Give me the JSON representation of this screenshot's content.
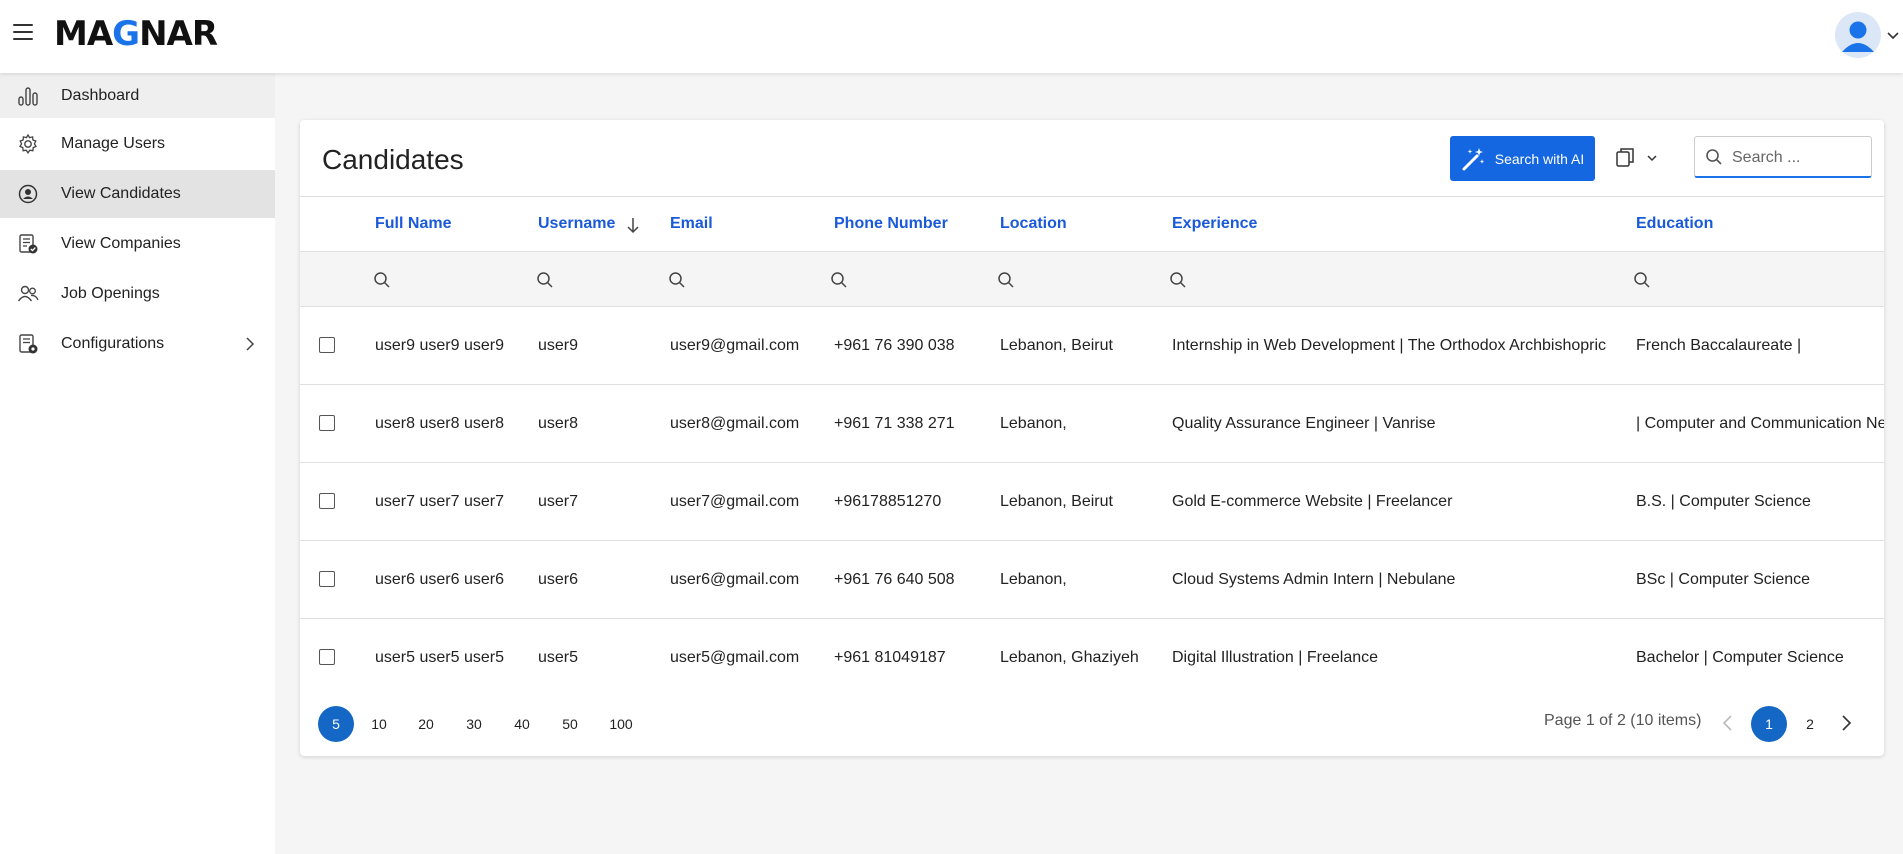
{
  "app": {
    "logo_prefix": "MA",
    "logo_accent": "G",
    "logo_suffix": "NAR"
  },
  "sidebar": {
    "items": [
      {
        "label": "Dashboard",
        "icon": "bar-chart-icon"
      },
      {
        "label": "Manage Users",
        "icon": "gear-icon"
      },
      {
        "label": "View Candidates",
        "icon": "user-circle-icon",
        "active": true
      },
      {
        "label": "View Companies",
        "icon": "document-check-icon"
      },
      {
        "label": "Job Openings",
        "icon": "users-icon"
      },
      {
        "label": "Configurations",
        "icon": "document-gear-icon",
        "has_submenu": true
      }
    ]
  },
  "page": {
    "title": "Candidates",
    "ai_button": "Search with AI",
    "search_placeholder": "Search ..."
  },
  "table": {
    "columns": [
      "Full Name",
      "Username",
      "Email",
      "Phone Number",
      "Location",
      "Experience",
      "Education"
    ],
    "sorted_column": "Username",
    "sort_direction": "descending",
    "rows": [
      [
        "user9 user9 user9",
        "user9",
        "user9@gmail.com",
        "+961 76 390 038",
        "Lebanon, Beirut",
        "Internship in Web Development | The Orthodox Archbishopric",
        "French Baccalaureate |"
      ],
      [
        "user8 user8 user8",
        "user8",
        "user8@gmail.com",
        "+961 71 338 271",
        "Lebanon,",
        "Quality Assurance Engineer | Vanrise",
        "| Computer and Communication Networks"
      ],
      [
        "user7 user7 user7",
        "user7",
        "user7@gmail.com",
        "+96178851270",
        "Lebanon, Beirut",
        "Gold E-commerce Website | Freelancer",
        "B.S. | Computer Science"
      ],
      [
        "user6 user6 user6",
        "user6",
        "user6@gmail.com",
        "+961 76 640 508",
        "Lebanon,",
        "Cloud Systems Admin Intern | Nebulane",
        "BSc | Computer Science"
      ],
      [
        "user5 user5 user5",
        "user5",
        "user5@gmail.com",
        "+961 81049187",
        "Lebanon, Ghaziyeh",
        "Digital Illustration | Freelance",
        "Bachelor | Computer Science"
      ]
    ]
  },
  "pagination": {
    "page_sizes": [
      "5",
      "10",
      "20",
      "30",
      "40",
      "50",
      "100"
    ],
    "selected_page_size": "5",
    "info": "Page 1 of 2 (10 items)",
    "pages": [
      "1",
      "2"
    ],
    "current_page": "1"
  },
  "colors": {
    "accent": "#1467e0",
    "header_text": "#1a5ad9",
    "selected": "#1467c4"
  }
}
